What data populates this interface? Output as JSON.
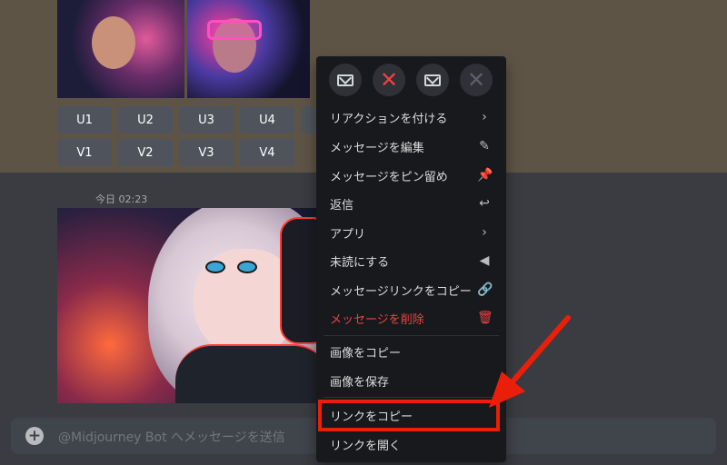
{
  "message_buttons": {
    "row1": [
      "U1",
      "U2",
      "U3",
      "U4"
    ],
    "row2": [
      "V1",
      "V2",
      "V3",
      "V4"
    ]
  },
  "message": {
    "timestamp": "今日 02:23"
  },
  "composer": {
    "placeholder": "@Midjourney Bot へメッセージを送信"
  },
  "context_menu": {
    "quick_reactions": [
      {
        "icon": "mail-icon"
      },
      {
        "icon": "x-icon",
        "color": "#ed4245"
      },
      {
        "icon": "mail-icon"
      },
      {
        "icon": "x-icon",
        "color": "#5d6066"
      }
    ],
    "items": [
      {
        "label": "リアクションを付ける",
        "icon": "chevron-right-icon"
      },
      {
        "label": "メッセージを編集",
        "icon": "pencil-icon"
      },
      {
        "label": "メッセージをピン留め",
        "icon": "pin-icon"
      },
      {
        "label": "返信",
        "icon": "reply-icon"
      },
      {
        "label": "アプリ",
        "icon": "chevron-right-icon"
      },
      {
        "label": "未読にする",
        "icon": "tag-icon"
      },
      {
        "label": "メッセージリンクをコピー",
        "icon": "link-icon"
      },
      {
        "label": "メッセージを削除",
        "icon": "trash-icon",
        "danger": true
      },
      {
        "label": "画像をコピー"
      },
      {
        "label": "画像を保存"
      },
      {
        "label": "リンクをコピー",
        "highlighted": true
      },
      {
        "label": "リンクを開く"
      }
    ]
  },
  "colors": {
    "danger": "#ed4245",
    "annotation": "#ea1f0a",
    "menu_bg": "#18191c",
    "chat_bg": "#36393f"
  }
}
